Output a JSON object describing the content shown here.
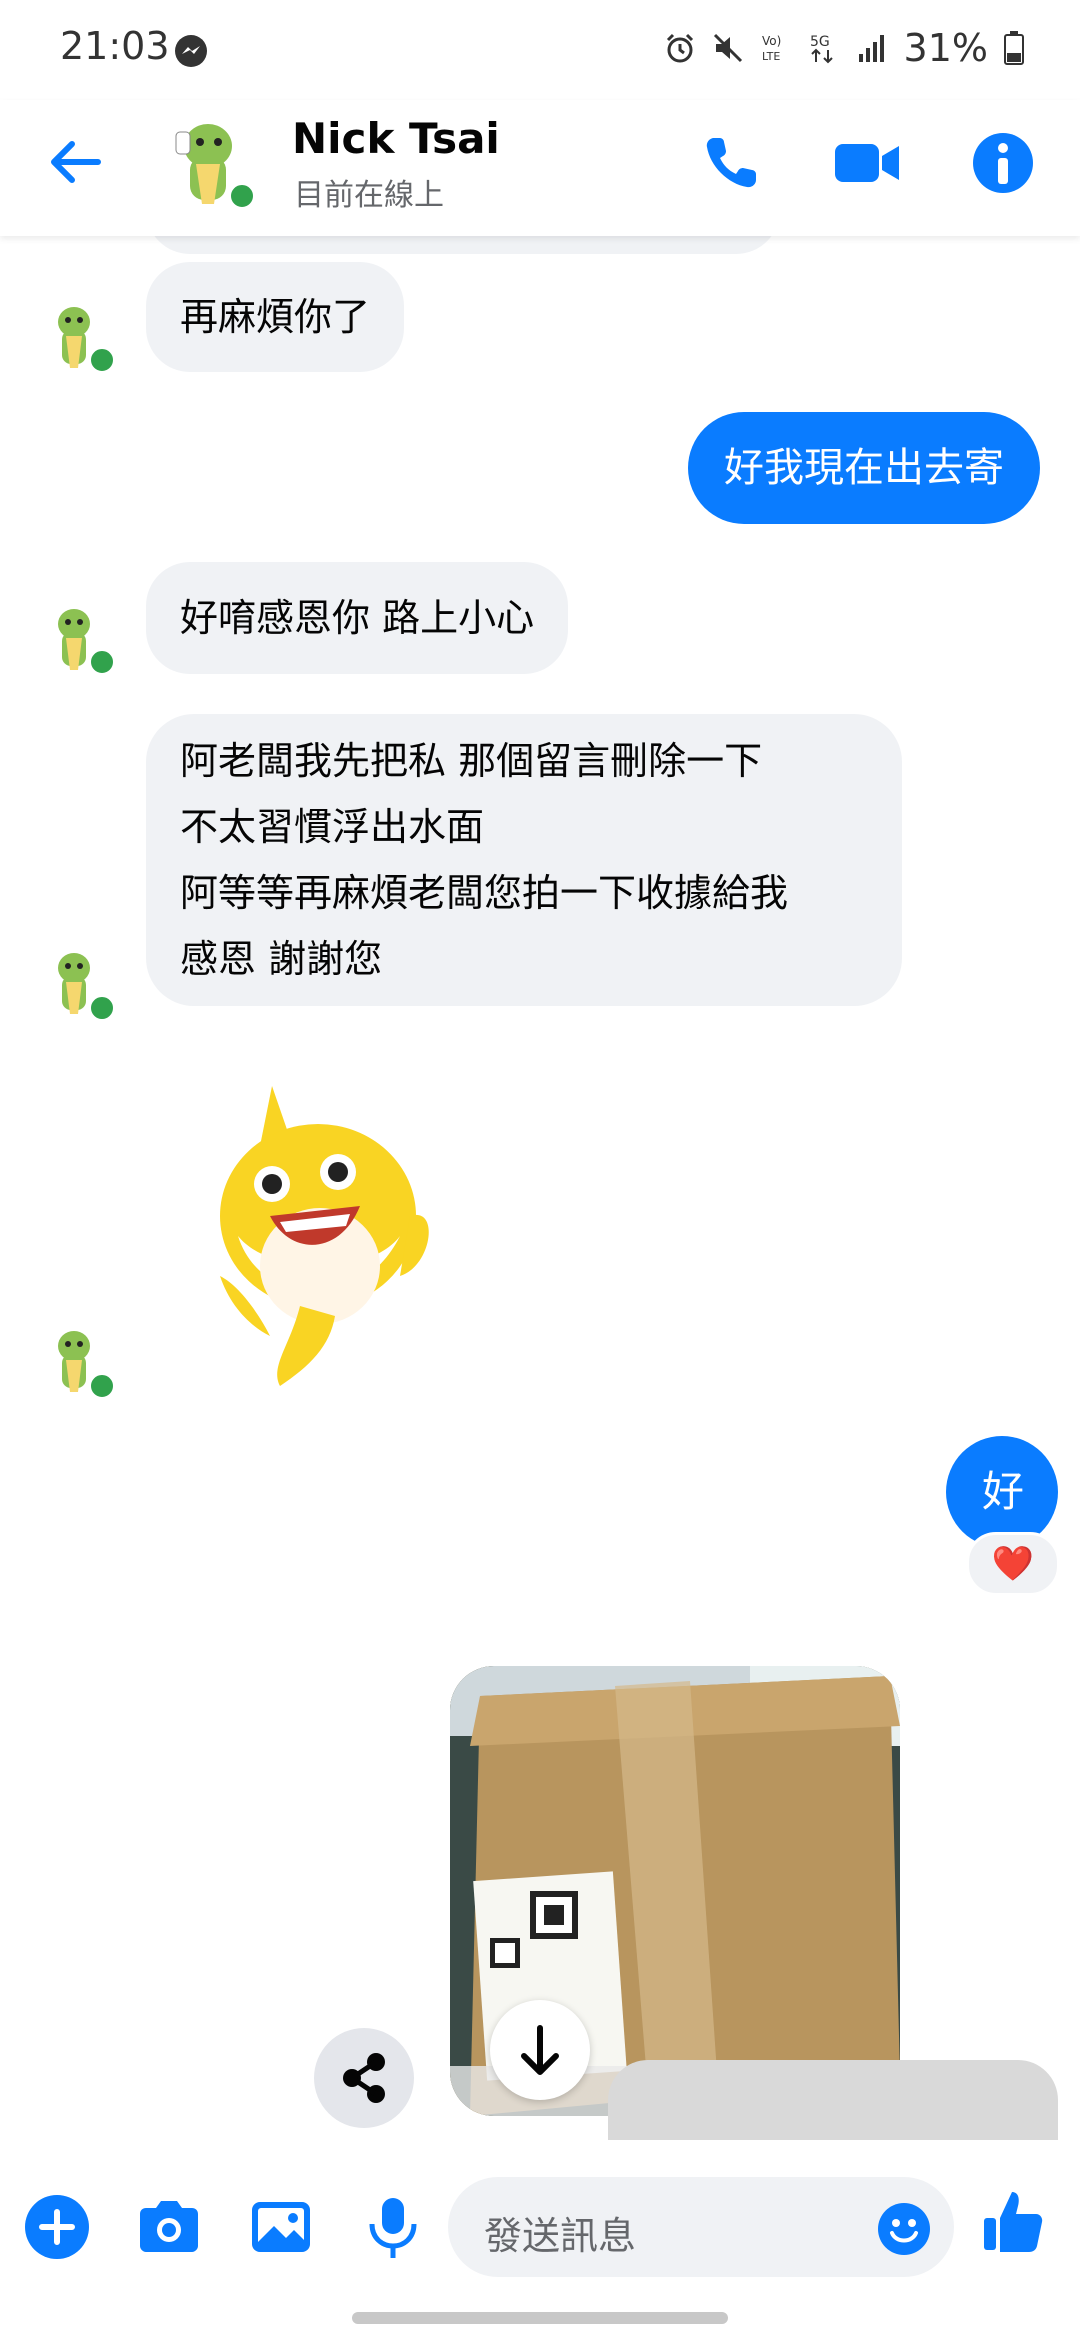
{
  "status_bar": {
    "time": "21:03",
    "battery": "31%",
    "network": "5G"
  },
  "header": {
    "contact_name": "Nick Tsai",
    "contact_status": "目前在線上",
    "back_icon": "arrow-left-icon",
    "call_icon": "phone-icon",
    "video_icon": "video-camera-icon",
    "info_icon": "info-icon",
    "accent_color": "#0a7cff"
  },
  "messages": [
    {
      "from": "contact",
      "text": "再麻煩你了"
    },
    {
      "from": "me",
      "text": "好我現在出去寄"
    },
    {
      "from": "contact",
      "text": "好唷感恩你 路上小心"
    },
    {
      "from": "contact",
      "lines": [
        "阿老闆我先把私 那個留言刪除一下",
        "不太習慣浮出水面",
        "阿等等再麻煩老闆您拍一下收據給我",
        "感恩 謝謝您"
      ]
    },
    {
      "from": "contact",
      "type": "sticker",
      "sticker": "baby-shark-sticker"
    },
    {
      "from": "me",
      "text": "好",
      "reaction": "❤️"
    },
    {
      "from": "me",
      "type": "photo",
      "photo": "cardboard-box-photo"
    }
  ],
  "composer": {
    "placeholder": "發送訊息",
    "icons": [
      "plus-icon",
      "camera-icon",
      "image-icon",
      "microphone-icon",
      "emoji-icon",
      "thumbs-up-icon"
    ]
  },
  "floating": {
    "share_icon": "share-icon",
    "scroll_down_icon": "arrow-down-icon"
  }
}
